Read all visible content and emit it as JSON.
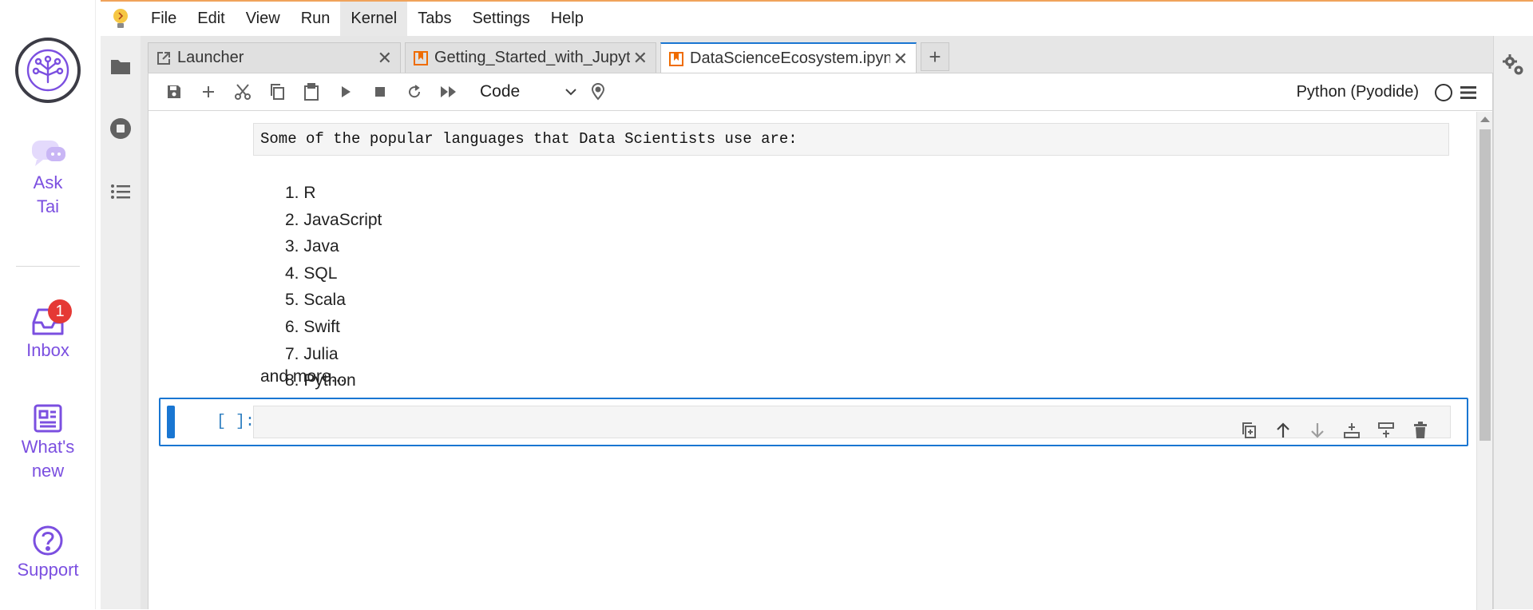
{
  "sidebar": {
    "items": [
      {
        "label": "Ask\nTai",
        "icon": "chat-bot-icon"
      },
      {
        "label": "Inbox",
        "icon": "inbox-icon",
        "badge": "1"
      },
      {
        "label": "What's\nnew",
        "icon": "newspaper-icon"
      },
      {
        "label": "Support",
        "icon": "help-circle-icon"
      }
    ],
    "accent": "#7b4fe0"
  },
  "menu": {
    "items": [
      "File",
      "Edit",
      "View",
      "Run",
      "Kernel",
      "Tabs",
      "Settings",
      "Help"
    ],
    "active": "Kernel"
  },
  "tabs": [
    {
      "label": "Launcher",
      "icon": "launcher-icon"
    },
    {
      "label": "Getting_Started_with_Jupyter",
      "icon": "notebook-icon"
    },
    {
      "label": "DataScienceEcosystem.ipynb",
      "icon": "notebook-icon",
      "current": true
    }
  ],
  "toolbar": {
    "cell_type": "Code",
    "kernel_name": "Python (Pyodide)"
  },
  "notebook": {
    "md_heading": "Some of the popular languages that Data Scientists use are:",
    "languages": [
      "1. R",
      "2. JavaScript",
      "3. Java",
      "4. SQL",
      "5. Scala",
      "6. Swift",
      "7. Julia",
      "8. Python"
    ],
    "md_more": "and more...",
    "code_prompt": "[ ]:"
  },
  "colors": {
    "selection": "#1976d2",
    "menu_accent": "#f0a35b",
    "badge": "#e53935"
  }
}
